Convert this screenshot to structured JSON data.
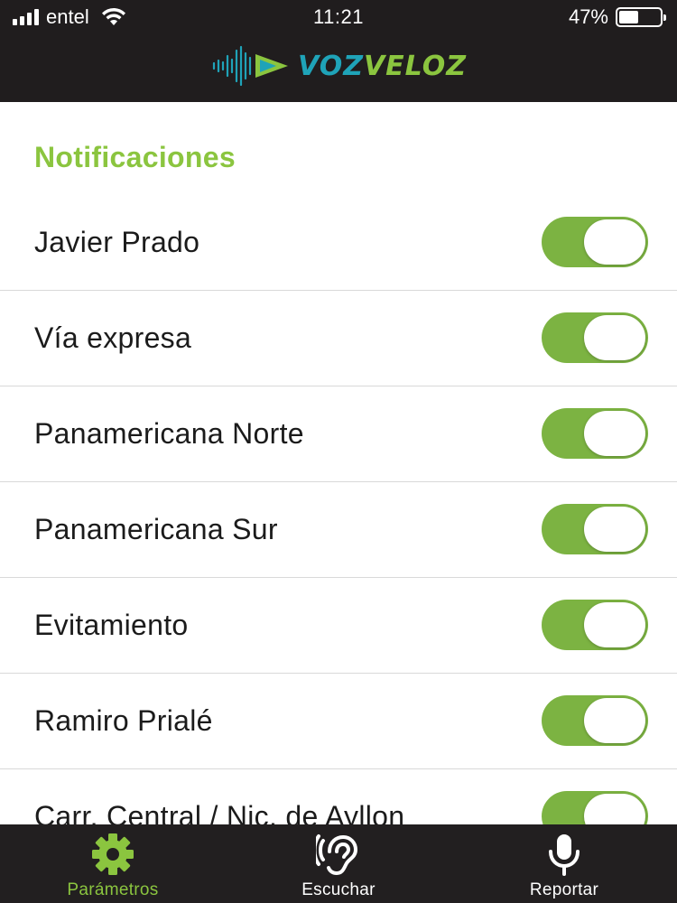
{
  "status_bar": {
    "carrier": "entel",
    "time": "11:21",
    "battery_percent_label": "47%",
    "battery_level": 0.47
  },
  "header": {
    "brand_part1": "VOZ",
    "brand_part2": "VELOZ",
    "brand_colors": {
      "voz": "#1fa3b8",
      "veloz": "#8bc53f"
    }
  },
  "section": {
    "title": "Notificaciones"
  },
  "notifications": [
    {
      "label": "Javier Prado",
      "enabled": true
    },
    {
      "label": "Vía expresa",
      "enabled": true
    },
    {
      "label": "Panamericana Norte",
      "enabled": true
    },
    {
      "label": "Panamericana Sur",
      "enabled": true
    },
    {
      "label": "Evitamiento",
      "enabled": true
    },
    {
      "label": "Ramiro Prialé",
      "enabled": true
    },
    {
      "label": "Carr. Central / Nic. de Ayllon",
      "enabled": true
    }
  ],
  "tabbar": {
    "tabs": [
      {
        "label": "Parámetros",
        "icon": "gear-icon",
        "active": true
      },
      {
        "label": "Escuchar",
        "icon": "ear-icon",
        "active": false
      },
      {
        "label": "Reportar",
        "icon": "microphone-icon",
        "active": false
      }
    ]
  },
  "colors": {
    "accent_green": "#8bc53f",
    "toggle_on": "#7cb342",
    "dark_bar": "#201d1e"
  }
}
